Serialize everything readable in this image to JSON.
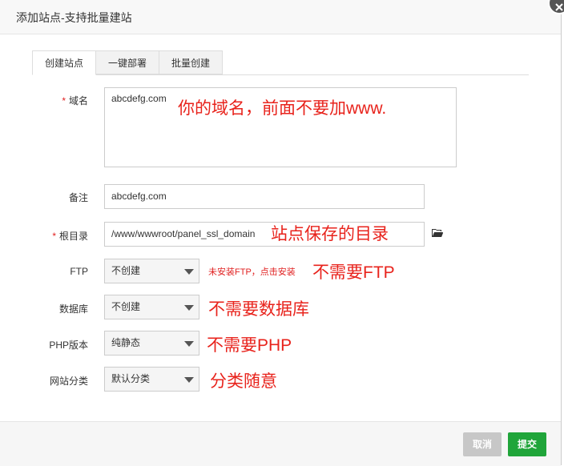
{
  "dialog": {
    "title": "添加站点-支持批量建站"
  },
  "tabs": [
    {
      "label": "创建站点"
    },
    {
      "label": "一键部署"
    },
    {
      "label": "批量创建"
    }
  ],
  "form": {
    "domain": {
      "label": "域名",
      "value": "abcdefg.com",
      "annotation": "你的域名，前面不要加www."
    },
    "remark": {
      "label": "备注",
      "value": "abcdefg.com"
    },
    "root": {
      "label": "根目录",
      "value": "/www/wwwroot/panel_ssl_domain",
      "annotation": "站点保存的目录"
    },
    "ftp": {
      "label": "FTP",
      "selected": "不创建",
      "hint": "未安装FTP，点击安装",
      "annotation": "不需要FTP"
    },
    "database": {
      "label": "数据库",
      "selected": "不创建",
      "annotation": "不需要数据库"
    },
    "php": {
      "label": "PHP版本",
      "selected": "纯静态",
      "annotation": "不需要PHP"
    },
    "category": {
      "label": "网站分类",
      "selected": "默认分类",
      "annotation": "分类随意"
    }
  },
  "footer": {
    "cancel_label": "取消",
    "submit_label": "提交"
  },
  "colors": {
    "accent": "#20a53a",
    "annotation": "#e8231c",
    "required": "#e02020"
  },
  "icons": {
    "close": "close-icon",
    "folder": "folder-open-icon"
  }
}
